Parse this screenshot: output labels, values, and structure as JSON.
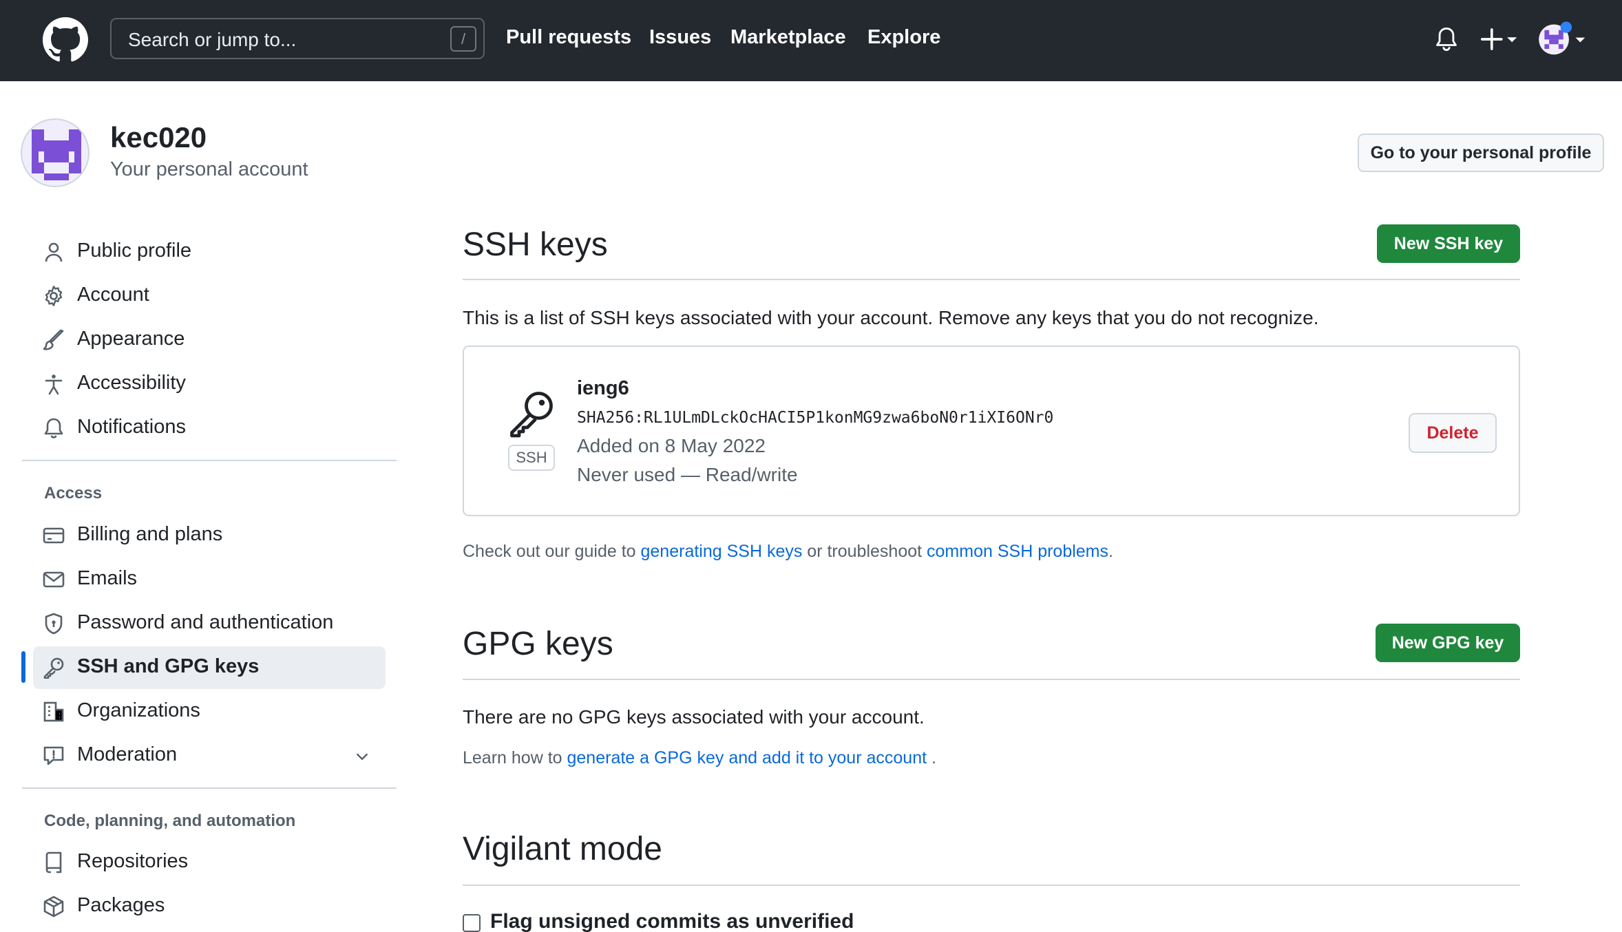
{
  "header": {
    "search_placeholder": "Search or jump to...",
    "search_shortcut": "/",
    "nav": [
      "Pull requests",
      "Issues",
      "Marketplace",
      "Explore"
    ]
  },
  "account": {
    "username": "kec020",
    "subtitle": "Your personal account",
    "profile_button": "Go to your personal profile"
  },
  "sidebar": {
    "items": [
      {
        "label": "Public profile",
        "icon": "person-icon"
      },
      {
        "label": "Account",
        "icon": "gear-icon"
      },
      {
        "label": "Appearance",
        "icon": "paintbrush-icon"
      },
      {
        "label": "Accessibility",
        "icon": "accessibility-icon"
      },
      {
        "label": "Notifications",
        "icon": "bell-icon"
      }
    ],
    "access_heading": "Access",
    "access_items": [
      {
        "label": "Billing and plans",
        "icon": "credit-card-icon"
      },
      {
        "label": "Emails",
        "icon": "mail-icon"
      },
      {
        "label": "Password and authentication",
        "icon": "shield-lock-icon"
      },
      {
        "label": "SSH and GPG keys",
        "icon": "key-icon",
        "active": true
      },
      {
        "label": "Organizations",
        "icon": "organization-icon"
      },
      {
        "label": "Moderation",
        "icon": "report-icon"
      }
    ],
    "code_heading": "Code, planning, and automation",
    "code_items": [
      {
        "label": "Repositories",
        "icon": "repo-icon"
      },
      {
        "label": "Packages",
        "icon": "package-icon"
      }
    ]
  },
  "ssh": {
    "title": "SSH keys",
    "new_button": "New SSH key",
    "description": "This is a list of SSH keys associated with your account. Remove any keys that you do not recognize.",
    "key": {
      "badge": "SSH",
      "name": "ieng6",
      "fingerprint": "SHA256:RL1ULmDLckOcHACI5P1konMG9zwa6boN0r1iXI6ONr0",
      "added": "Added on 8 May 2022",
      "usage": "Never used — Read/write",
      "delete_label": "Delete"
    },
    "guide_prefix": "Check out our guide to ",
    "guide_link1": "generating SSH keys",
    "guide_middle": " or troubleshoot ",
    "guide_link2": "common SSH problems",
    "guide_suffix": "."
  },
  "gpg": {
    "title": "GPG keys",
    "new_button": "New GPG key",
    "empty": "There are no GPG keys associated with your account.",
    "learn_prefix": "Learn how to ",
    "learn_link": "generate a GPG key and add it to your account",
    "learn_suffix": " ."
  },
  "vigilant": {
    "title": "Vigilant mode",
    "checkbox_label": "Flag unsigned commits as unverified",
    "checked": false
  },
  "colors": {
    "header_bg": "#24292f",
    "primary_green": "#1f883d",
    "link_blue": "#0969da",
    "danger_red": "#cf222e",
    "avatar_purple": "#7b4fd6"
  }
}
